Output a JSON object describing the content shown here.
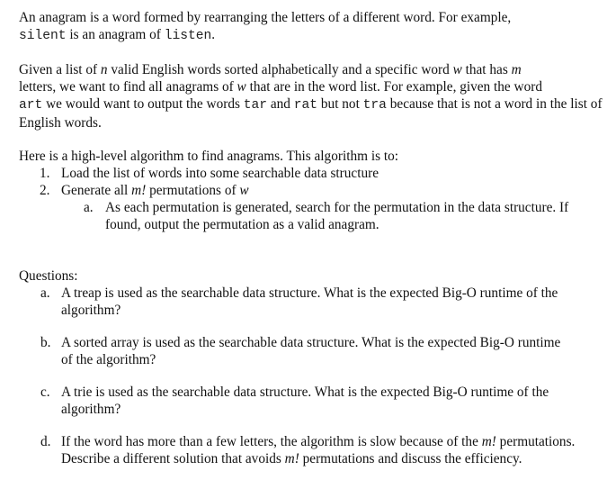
{
  "paragraph1": {
    "text_1": "An anagram is a word formed by rearranging the letters of a different word. For example,",
    "code_silent": "silent",
    "text_2": " is an anagram of ",
    "code_listen": "listen",
    "text_3": "."
  },
  "paragraph2": {
    "text_1": "Given a list of ",
    "var_n": "n",
    "text_2": " valid English words sorted alphabetically and a specific word ",
    "var_w": "w",
    "text_3": " that has ",
    "var_m": "m",
    "text_4": " letters, we want to find all anagrams of ",
    "var_w2": "w",
    "text_5": " that are in the word list. For example, given the word ",
    "code_art": "art",
    "text_6": " we would want to output the words ",
    "code_tar": "tar",
    "text_7": " and ",
    "code_rat": "rat",
    "text_8": " but not ",
    "code_tra": "tra",
    "text_9": " because that is not a word in the list of English words."
  },
  "algorithm": {
    "intro": "Here is a high-level algorithm to find anagrams.  This algorithm is to:",
    "steps": [
      {
        "number": "1.",
        "text": "Load the list of words into some searchable data structure"
      },
      {
        "number": "2.",
        "text_1": "Generate all ",
        "var_m": "m!",
        "text_2": " permutations of ",
        "var_w": "w",
        "substeps": [
          {
            "number": "a.",
            "text": "As each permutation is generated, search for the permutation in the data structure. If found, output the permutation as a valid anagram."
          }
        ]
      }
    ]
  },
  "questions": {
    "label": "Questions:",
    "items": [
      {
        "letter": "a.",
        "text": "A treap is used as the searchable data structure.  What is the expected Big-O runtime of the algorithm?"
      },
      {
        "letter": "b.",
        "text": "A sorted array is used as the searchable data structure. What is the expected Big-O runtime of the algorithm?"
      },
      {
        "letter": "c.",
        "text": "A trie is used as the searchable data structure. What is the expected Big-O runtime of the algorithm?"
      },
      {
        "letter": "d.",
        "text_1": "If the word has more than a few letters, the algorithm is slow because of the ",
        "var_m1": "m!",
        "text_2": " permutations.   Describe a different solution that avoids ",
        "var_m2": "m!",
        "text_3": " permutations and discuss the efficiency."
      }
    ]
  }
}
